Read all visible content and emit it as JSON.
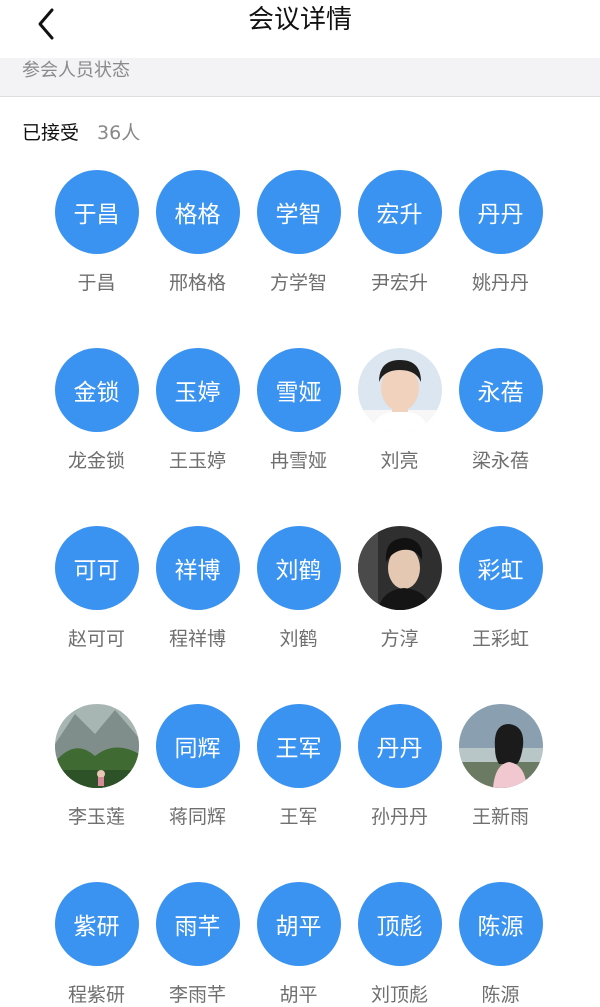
{
  "header": {
    "title": "会议详情",
    "back_icon": "chevron-left-icon"
  },
  "section": {
    "title": "参会人员状态"
  },
  "status": {
    "label": "已接受",
    "count": "36人"
  },
  "colors": {
    "avatar_bg": "#3a92f1"
  },
  "members": [
    {
      "avatar_text": "于昌",
      "name": "于昌"
    },
    {
      "avatar_text": "格格",
      "name": "邢格格"
    },
    {
      "avatar_text": "学智",
      "name": "方学智"
    },
    {
      "avatar_text": "宏升",
      "name": "尹宏升"
    },
    {
      "avatar_text": "丹丹",
      "name": "姚丹丹"
    },
    {
      "avatar_text": "金锁",
      "name": "龙金锁"
    },
    {
      "avatar_text": "玉婷",
      "name": "王玉婷"
    },
    {
      "avatar_text": "雪娅",
      "name": "冉雪娅"
    },
    {
      "avatar_text": "",
      "name": "刘亮",
      "photo": "young man portrait, light blue background"
    },
    {
      "avatar_text": "永蓓",
      "name": "梁永蓓"
    },
    {
      "avatar_text": "可可",
      "name": "赵可可"
    },
    {
      "avatar_text": "祥博",
      "name": "程祥博"
    },
    {
      "avatar_text": "刘鹤",
      "name": "刘鹤"
    },
    {
      "avatar_text": "",
      "name": "方淳",
      "photo": "man portrait, dark background"
    },
    {
      "avatar_text": "彩虹",
      "name": "王彩虹"
    },
    {
      "avatar_text": "",
      "name": "李玉莲",
      "photo": "mountain forest landscape"
    },
    {
      "avatar_text": "同辉",
      "name": "蒋同辉"
    },
    {
      "avatar_text": "王军",
      "name": "王军"
    },
    {
      "avatar_text": "丹丹",
      "name": "孙丹丹"
    },
    {
      "avatar_text": "",
      "name": "王新雨",
      "photo": "girl by lake"
    },
    {
      "avatar_text": "紫研",
      "name": "程紫研"
    },
    {
      "avatar_text": "雨芊",
      "name": "李雨芊"
    },
    {
      "avatar_text": "胡平",
      "name": "胡平"
    },
    {
      "avatar_text": "顶彪",
      "name": "刘顶彪"
    },
    {
      "avatar_text": "陈源",
      "name": "陈源"
    }
  ]
}
